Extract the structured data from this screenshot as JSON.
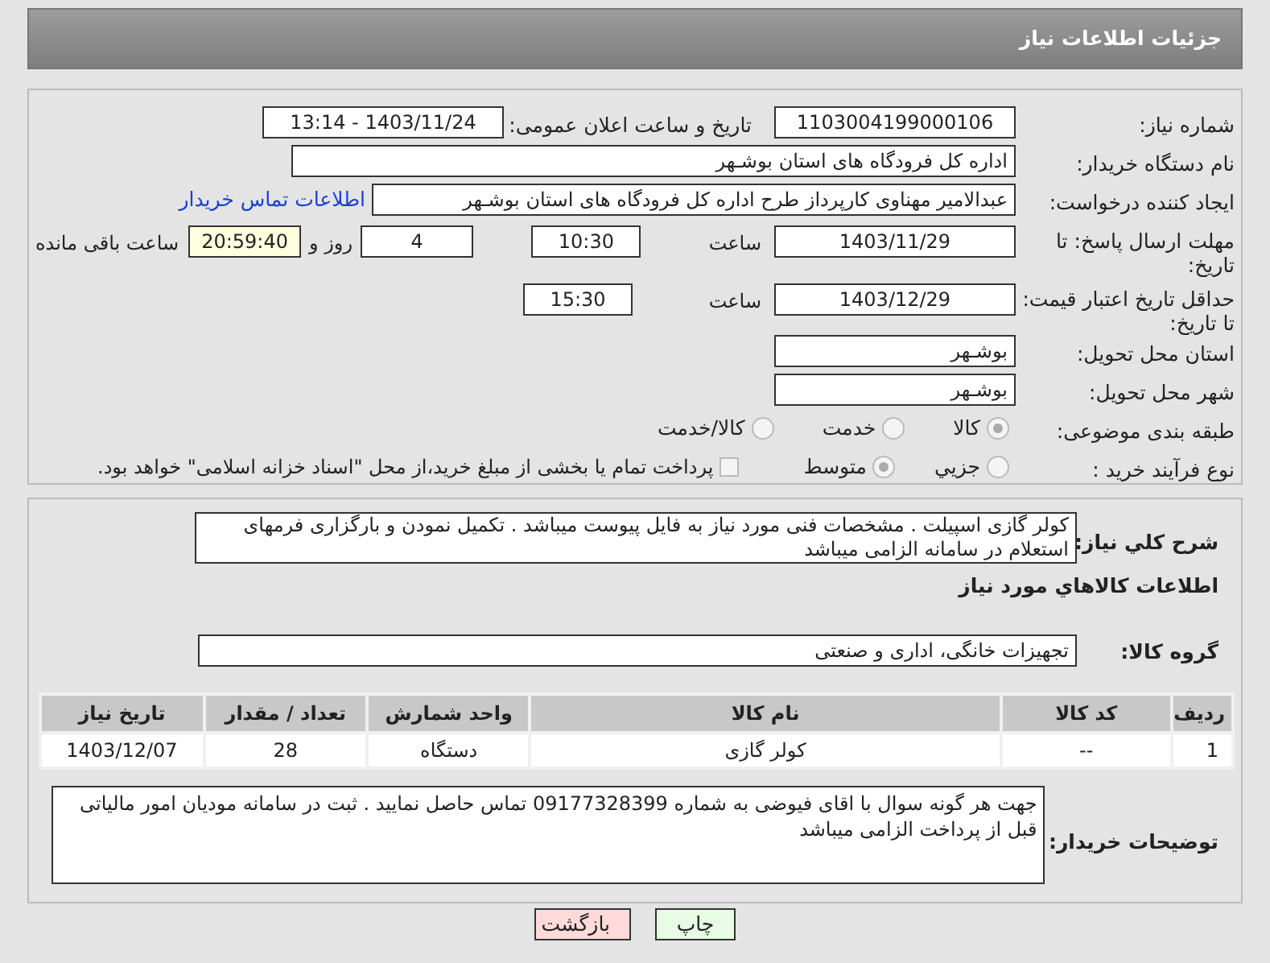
{
  "header": {
    "title": "جزئیات اطلاعات نیاز"
  },
  "fields": {
    "need_number": {
      "label": "شماره نیاز:",
      "value": "1103004199000106"
    },
    "announce": {
      "label": "تاریخ و ساعت اعلان عمومی:",
      "value": "1403/11/24 - 13:14"
    },
    "buyer": {
      "label": "نام دستگاه خریدار:",
      "value": "اداره کل فرودگاه های استان بوشـهر"
    },
    "requester": {
      "label": "ایجاد کننده درخواست:",
      "value": "عبدالامیر مهناوی کارپرداز طرح اداره کل فرودگاه های استان بوشـهر",
      "link": "اطلاعات تماس خریدار"
    },
    "deadline": {
      "label": "مهلت ارسال پاسخ: تا تاریخ:",
      "date": "1403/11/29",
      "time_label": "ساعت",
      "time": "10:30",
      "days": "4",
      "days_label": "روز و",
      "remaining": "20:59:40",
      "remaining_label": "ساعت باقی مانده"
    },
    "validity": {
      "label": "حداقل تاریخ اعتبار قیمت: تا تاریخ:",
      "date": "1403/12/29",
      "time_label": "ساعت",
      "time": "15:30"
    },
    "province": {
      "label": "استان محل تحویل:",
      "value": "بوشـهر"
    },
    "city": {
      "label": "شهر محل تحویل:",
      "value": "بوشـهر"
    },
    "category": {
      "label": "طبقه بندی موضوعی:",
      "options": [
        {
          "label": "کالا",
          "selected": true
        },
        {
          "label": "خدمت",
          "selected": false
        },
        {
          "label": "کالا/خدمت",
          "selected": false
        }
      ]
    },
    "process": {
      "label": "نوع فرآیند خرید :",
      "options": [
        {
          "label": "جزیي",
          "selected": false
        },
        {
          "label": "متوسط",
          "selected": true
        }
      ],
      "treasury": {
        "label": "پرداخت تمام یا بخشی از مبلغ خرید،از محل \"اسناد خزانه اسلامی\" خواهد بود.",
        "checked": false
      }
    }
  },
  "description": {
    "label": "شرح کلي نياز:",
    "value": "کولر گازی اسپیلت . مشخصات فنی مورد نیاز به فایل پیوست میباشد . تکمیل نمودن و بارگزاری فرمهای استعلام در سامانه الزامی میباشد"
  },
  "goods_title": "اطلاعات کالاهاي مورد نياز",
  "goods_group": {
    "label": "گروه کالا:",
    "value": "تجهیزات خانگی، اداری و صنعتی"
  },
  "table": {
    "columns": [
      "ردیف",
      "کد کالا",
      "نام کالا",
      "واحد شمارش",
      "تعداد / مقدار",
      "تاریخ نیاز"
    ],
    "rows": [
      [
        "1",
        "--",
        "کولر گازی",
        "دستگاه",
        "28",
        "1403/12/07"
      ]
    ]
  },
  "notes": {
    "label": "توضیحات خریدار:",
    "value": "جهت هر گونه سوال با اقای فیوضی به شماره 09177328399 تماس حاصل نمایید . ثبت در سامانه مودیان امور مالیاتی قبل از پرداخت الزامی میباشد"
  },
  "buttons": [
    {
      "label": "چاپ",
      "kind": "print"
    },
    {
      "label": "بازگشت",
      "kind": "back"
    }
  ]
}
